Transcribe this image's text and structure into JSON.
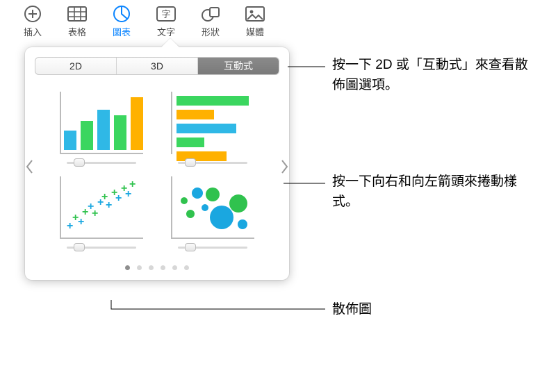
{
  "toolbar": {
    "insert": "插入",
    "table": "表格",
    "chart": "圖表",
    "text": "文字",
    "shape": "形狀",
    "media": "媒體"
  },
  "tabs": {
    "tab2d": "2D",
    "tab3d": "3D",
    "interactive": "互動式"
  },
  "callouts": {
    "tabs_hint": "按一下 2D 或「互動式」來查看散佈圖選項。",
    "arrows_hint": "按一下向右和向左箭頭來捲動樣式。",
    "scatter_label": "散佈圖"
  },
  "chart_types": {
    "bar": "直條圖",
    "hbar": "橫條圖",
    "scatter": "散佈圖",
    "bubble": "泡泡圖"
  },
  "page_dots": {
    "count": 6,
    "active": 0
  }
}
